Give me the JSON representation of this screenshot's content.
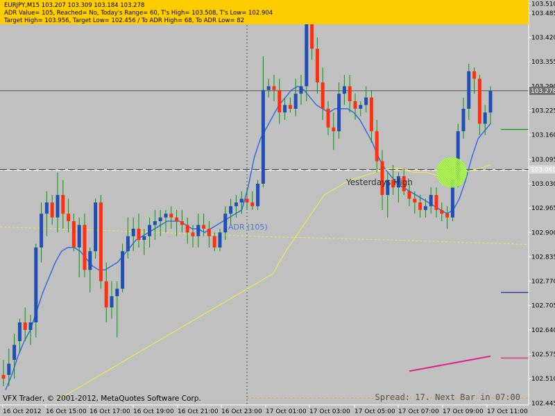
{
  "window": {
    "symbol_line": "EURJPY,M15  103.207 103.309 103.184 103.278",
    "adr_line": "ADR Value= 105, Reached= No, Today's Range= 60, T's High= 103.508, T's Low= 102.904",
    "target_line": "Target High= 103.956, Target Low= 102.456 / To ADR High= 68, To ADR Low= 82",
    "copyright": "VFX Trader, © 2001-2012, MetaQuotes Software Corp.",
    "spread_text": "Spread: 17. Next Bar in 07:00"
  },
  "colors": {
    "background": "#c0c0c0",
    "info_bar": "#ffcc00",
    "bull_candle": "#1f4fb4",
    "bear_candle": "#ff3010",
    "wick": "#009900",
    "fast_ma": "#3b6fe0",
    "slow_ma": "#f0f040",
    "magenta_line": "#e0208a",
    "bid_label_bg": "#6e6e6e",
    "ask_label_bg": "#dcdcdc",
    "target_zone": "#99ee33"
  },
  "chart_data": {
    "type": "candlestick",
    "ylim": [
      102.44,
      103.52
    ],
    "y_ticks": [
      "103.510",
      "103.485",
      "103.420",
      "103.355",
      "103.290",
      "103.225",
      "103.160",
      "103.095",
      "103.030",
      "102.965",
      "102.900",
      "102.835",
      "102.770",
      "102.705",
      "102.640",
      "102.575",
      "102.510",
      "102.445"
    ],
    "x_tick_labels": [
      "16 Oct 2012",
      "16 Oct 15:00",
      "16 Oct 17:00",
      "16 Oct 19:00",
      "16 Oct 21:00",
      "16 Oct 23:00",
      "17 Oct 01:00",
      "17 Oct 03:00",
      "17 Oct 05:00",
      "17 Oct 07:00",
      "17 Oct 09:00",
      "17 Oct 11:00"
    ],
    "current_price": "103.278",
    "current_price_value": 103.278,
    "ask_price": "103.068",
    "ask_price_value": 103.068,
    "indicators": {
      "adr_label": "ADR (105)",
      "yesterdays_high_label": "Yesterdays High"
    },
    "candles": [
      {
        "o": 102.52,
        "h": 102.56,
        "l": 102.49,
        "c": 102.51
      },
      {
        "o": 102.52,
        "h": 102.59,
        "l": 102.49,
        "c": 102.55
      },
      {
        "o": 102.56,
        "h": 102.63,
        "l": 102.51,
        "c": 102.6
      },
      {
        "o": 102.61,
        "h": 102.67,
        "l": 102.58,
        "c": 102.66
      },
      {
        "o": 102.66,
        "h": 102.7,
        "l": 102.61,
        "c": 102.64
      },
      {
        "o": 102.64,
        "h": 102.68,
        "l": 102.6,
        "c": 102.66
      },
      {
        "o": 102.66,
        "h": 102.87,
        "l": 102.62,
        "c": 102.86
      },
      {
        "o": 102.86,
        "h": 102.98,
        "l": 102.82,
        "c": 102.95
      },
      {
        "o": 102.95,
        "h": 103.01,
        "l": 102.89,
        "c": 102.98
      },
      {
        "o": 102.98,
        "h": 103.0,
        "l": 102.92,
        "c": 102.94
      },
      {
        "o": 102.94,
        "h": 103.06,
        "l": 102.9,
        "c": 103.0
      },
      {
        "o": 103.0,
        "h": 103.04,
        "l": 102.91,
        "c": 102.95
      },
      {
        "o": 102.95,
        "h": 102.99,
        "l": 102.9,
        "c": 102.93
      },
      {
        "o": 102.93,
        "h": 102.95,
        "l": 102.85,
        "c": 102.86
      },
      {
        "o": 102.86,
        "h": 102.94,
        "l": 102.78,
        "c": 102.92
      },
      {
        "o": 102.92,
        "h": 102.95,
        "l": 102.78,
        "c": 102.8
      },
      {
        "o": 102.8,
        "h": 102.86,
        "l": 102.74,
        "c": 102.85
      },
      {
        "o": 102.85,
        "h": 102.99,
        "l": 102.83,
        "c": 102.98
      },
      {
        "o": 102.98,
        "h": 103.0,
        "l": 102.75,
        "c": 102.77
      },
      {
        "o": 102.77,
        "h": 102.82,
        "l": 102.66,
        "c": 102.7
      },
      {
        "o": 102.7,
        "h": 102.77,
        "l": 102.67,
        "c": 102.73
      },
      {
        "o": 102.73,
        "h": 102.77,
        "l": 102.62,
        "c": 102.75
      },
      {
        "o": 102.75,
        "h": 102.87,
        "l": 102.74,
        "c": 102.85
      },
      {
        "o": 102.85,
        "h": 102.94,
        "l": 102.83,
        "c": 102.89
      },
      {
        "o": 102.89,
        "h": 102.94,
        "l": 102.85,
        "c": 102.91
      },
      {
        "o": 102.91,
        "h": 102.95,
        "l": 102.86,
        "c": 102.88
      },
      {
        "o": 102.88,
        "h": 102.91,
        "l": 102.84,
        "c": 102.89
      },
      {
        "o": 102.89,
        "h": 102.94,
        "l": 102.86,
        "c": 102.92
      },
      {
        "o": 102.92,
        "h": 102.96,
        "l": 102.88,
        "c": 102.93
      },
      {
        "o": 102.93,
        "h": 102.96,
        "l": 102.89,
        "c": 102.94
      },
      {
        "o": 102.94,
        "h": 102.96,
        "l": 102.9,
        "c": 102.95
      },
      {
        "o": 102.95,
        "h": 102.97,
        "l": 102.91,
        "c": 102.94
      },
      {
        "o": 102.94,
        "h": 102.96,
        "l": 102.89,
        "c": 102.93
      },
      {
        "o": 102.93,
        "h": 102.96,
        "l": 102.9,
        "c": 102.92
      },
      {
        "o": 102.92,
        "h": 102.94,
        "l": 102.87,
        "c": 102.9
      },
      {
        "o": 102.9,
        "h": 102.92,
        "l": 102.86,
        "c": 102.89
      },
      {
        "o": 102.89,
        "h": 102.95,
        "l": 102.86,
        "c": 102.92
      },
      {
        "o": 102.92,
        "h": 102.95,
        "l": 102.89,
        "c": 102.91
      },
      {
        "o": 102.91,
        "h": 102.93,
        "l": 102.86,
        "c": 102.89
      },
      {
        "o": 102.89,
        "h": 102.9,
        "l": 102.85,
        "c": 102.86
      },
      {
        "o": 102.86,
        "h": 102.91,
        "l": 102.85,
        "c": 102.9
      },
      {
        "o": 102.9,
        "h": 102.97,
        "l": 102.88,
        "c": 102.95
      },
      {
        "o": 102.95,
        "h": 102.99,
        "l": 102.92,
        "c": 102.97
      },
      {
        "o": 102.97,
        "h": 103.0,
        "l": 102.94,
        "c": 102.98
      },
      {
        "o": 102.98,
        "h": 103.01,
        "l": 102.95,
        "c": 102.99
      },
      {
        "o": 102.99,
        "h": 103.02,
        "l": 102.96,
        "c": 102.98
      },
      {
        "o": 102.98,
        "h": 103.01,
        "l": 102.96,
        "c": 102.97
      },
      {
        "o": 102.97,
        "h": 103.04,
        "l": 102.96,
        "c": 103.03
      },
      {
        "o": 103.03,
        "h": 103.37,
        "l": 103.02,
        "c": 103.28
      },
      {
        "o": 103.28,
        "h": 103.31,
        "l": 103.26,
        "c": 103.29
      },
      {
        "o": 103.29,
        "h": 103.32,
        "l": 103.25,
        "c": 103.28
      },
      {
        "o": 103.28,
        "h": 103.31,
        "l": 103.19,
        "c": 103.22
      },
      {
        "o": 103.22,
        "h": 103.26,
        "l": 103.2,
        "c": 103.24
      },
      {
        "o": 103.24,
        "h": 103.26,
        "l": 103.22,
        "c": 103.23
      },
      {
        "o": 103.23,
        "h": 103.31,
        "l": 103.21,
        "c": 103.27
      },
      {
        "o": 103.27,
        "h": 103.32,
        "l": 103.24,
        "c": 103.29
      },
      {
        "o": 103.29,
        "h": 103.51,
        "l": 103.25,
        "c": 103.47
      },
      {
        "o": 103.47,
        "h": 103.49,
        "l": 103.36,
        "c": 103.39
      },
      {
        "o": 103.39,
        "h": 103.42,
        "l": 103.27,
        "c": 103.3
      },
      {
        "o": 103.3,
        "h": 103.34,
        "l": 103.2,
        "c": 103.23
      },
      {
        "o": 103.23,
        "h": 103.25,
        "l": 103.16,
        "c": 103.18
      },
      {
        "o": 103.18,
        "h": 103.22,
        "l": 103.12,
        "c": 103.17
      },
      {
        "o": 103.17,
        "h": 103.3,
        "l": 103.15,
        "c": 103.27
      },
      {
        "o": 103.27,
        "h": 103.32,
        "l": 103.24,
        "c": 103.29
      },
      {
        "o": 103.29,
        "h": 103.32,
        "l": 103.22,
        "c": 103.25
      },
      {
        "o": 103.25,
        "h": 103.27,
        "l": 103.2,
        "c": 103.23
      },
      {
        "o": 103.23,
        "h": 103.25,
        "l": 103.21,
        "c": 103.24
      },
      {
        "o": 103.24,
        "h": 103.29,
        "l": 103.22,
        "c": 103.26
      },
      {
        "o": 103.26,
        "h": 103.28,
        "l": 103.14,
        "c": 103.17
      },
      {
        "o": 103.17,
        "h": 103.2,
        "l": 103.06,
        "c": 103.09
      },
      {
        "o": 103.09,
        "h": 103.12,
        "l": 102.96,
        "c": 103.0
      },
      {
        "o": 103.0,
        "h": 103.06,
        "l": 102.94,
        "c": 103.04
      },
      {
        "o": 103.04,
        "h": 103.08,
        "l": 103.0,
        "c": 103.02
      },
      {
        "o": 103.02,
        "h": 103.06,
        "l": 102.98,
        "c": 103.05
      },
      {
        "o": 103.05,
        "h": 103.07,
        "l": 103.0,
        "c": 103.01
      },
      {
        "o": 103.01,
        "h": 103.03,
        "l": 102.97,
        "c": 102.99
      },
      {
        "o": 102.99,
        "h": 103.01,
        "l": 102.95,
        "c": 102.98
      },
      {
        "o": 102.98,
        "h": 103.0,
        "l": 102.94,
        "c": 102.96
      },
      {
        "o": 102.96,
        "h": 102.99,
        "l": 102.94,
        "c": 102.97
      },
      {
        "o": 102.97,
        "h": 103.02,
        "l": 102.95,
        "c": 103.0
      },
      {
        "o": 103.0,
        "h": 103.02,
        "l": 102.94,
        "c": 102.96
      },
      {
        "o": 102.96,
        "h": 102.98,
        "l": 102.93,
        "c": 102.95
      },
      {
        "o": 102.95,
        "h": 102.97,
        "l": 102.91,
        "c": 102.94
      },
      {
        "o": 102.94,
        "h": 103.06,
        "l": 102.93,
        "c": 103.04
      },
      {
        "o": 103.04,
        "h": 103.19,
        "l": 103.02,
        "c": 103.17
      },
      {
        "o": 103.17,
        "h": 103.26,
        "l": 103.15,
        "c": 103.23
      },
      {
        "o": 103.23,
        "h": 103.35,
        "l": 103.2,
        "c": 103.33
      },
      {
        "o": 103.33,
        "h": 103.34,
        "l": 103.27,
        "c": 103.31
      },
      {
        "o": 103.31,
        "h": 103.32,
        "l": 103.16,
        "c": 103.19
      },
      {
        "o": 103.19,
        "h": 103.24,
        "l": 103.16,
        "c": 103.22
      },
      {
        "o": 103.22,
        "h": 103.29,
        "l": 103.19,
        "c": 103.278
      }
    ],
    "fast_ma": [
      102.48,
      102.52,
      102.57,
      102.61,
      102.64,
      102.69,
      102.74,
      102.78,
      102.82,
      102.85,
      102.86,
      102.86,
      102.85,
      102.83,
      102.81,
      102.8,
      102.8,
      102.81,
      102.82,
      102.84,
      102.86,
      102.88,
      102.89,
      102.9,
      102.91,
      102.92,
      102.93,
      102.93,
      102.93,
      102.92,
      102.91,
      102.91,
      102.9,
      102.91,
      102.92,
      102.93,
      102.94,
      102.95,
      102.96,
      103.02,
      103.1,
      103.15,
      103.18,
      103.21,
      103.24,
      103.26,
      103.28,
      103.29,
      103.28,
      103.26,
      103.24,
      103.23,
      103.22,
      103.23,
      103.23,
      103.23,
      103.22,
      103.2,
      103.17,
      103.14,
      103.1,
      103.07,
      103.05,
      103.03,
      103.02,
      103.01,
      103.0,
      102.99,
      102.98,
      102.97,
      102.96,
      102.95,
      102.96,
      102.99,
      103.04,
      103.1,
      103.15,
      103.17,
      103.19
    ],
    "slow_ma": [
      102.45,
      102.47,
      102.49,
      102.51,
      102.53,
      102.55,
      102.57,
      102.59,
      102.61,
      102.63,
      102.65,
      102.67,
      102.69,
      102.71,
      102.73,
      102.75,
      102.77,
      102.79,
      102.85,
      102.9,
      102.95,
      103.0,
      103.02,
      103.04,
      103.05,
      103.06,
      103.07,
      103.07,
      103.06,
      103.06,
      103.05,
      103.05,
      103.06,
      103.07,
      103.08
    ],
    "magenta_line": [
      102.53,
      102.54,
      102.55,
      102.56,
      102.57
    ]
  }
}
